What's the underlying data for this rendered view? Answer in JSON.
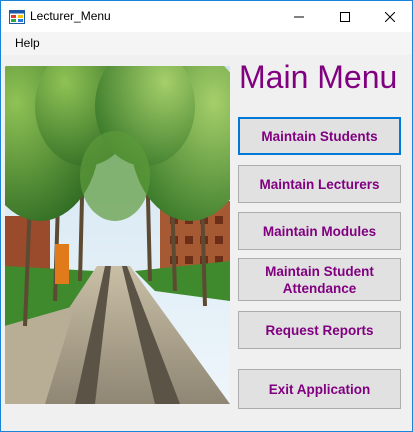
{
  "window": {
    "title": "Lecturer_Menu",
    "accent_color": "#0078d7"
  },
  "menubar": {
    "items": [
      "Help"
    ]
  },
  "main": {
    "title": "Main Menu",
    "title_color": "#800080",
    "photo_description_icon": "campus-walkway-photo",
    "buttons": [
      "Maintain Students",
      "Maintain Lecturers",
      "Maintain Modules",
      "Maintain Student Attendance",
      "Request Reports",
      "Exit Application"
    ]
  }
}
